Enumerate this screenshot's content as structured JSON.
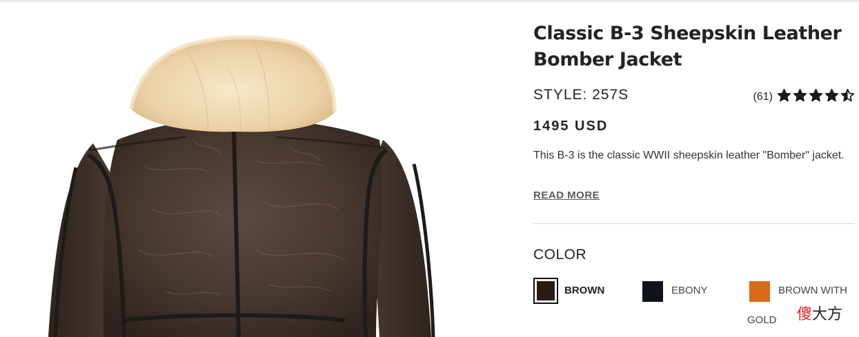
{
  "product": {
    "title_line1": "Classic B-3 Sheepskin Leather",
    "title_line2": "Bomber Jacket",
    "style_label": "STYLE: 257S",
    "rating_count": "(61)",
    "rating_value": 4.5,
    "rating_max": 5,
    "price": "1495 USD",
    "description": "This B-3 is the classic WWII sheepskin leather \"Bomber\" jacket.",
    "read_more": "READ MORE",
    "image_alt": "Back view of brown sheepskin leather bomber jacket with cream shearling collar"
  },
  "color_section": {
    "label": "COLOR",
    "options": [
      {
        "name": "BROWN",
        "hex": "#2a1a18",
        "selected": true
      },
      {
        "name": "EBONY",
        "hex": "#10121c",
        "selected": false
      },
      {
        "name": "BROWN WITH",
        "name_line2": "GOLD",
        "hex": "#d96a16",
        "selected": false
      }
    ]
  },
  "watermark": {
    "char1": "傻",
    "rest": "大方"
  },
  "colors": {
    "star": "#1a1a1a",
    "jacket_leather": "#4a3a33",
    "collar": "#ecd3a9"
  }
}
